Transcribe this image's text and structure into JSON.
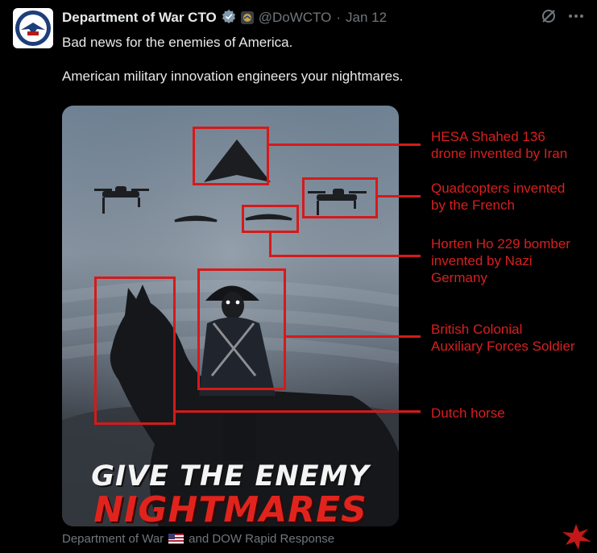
{
  "header": {
    "name": "Department of War CTO",
    "handle": "@DoWCTO",
    "separator": "·",
    "date": "Jan 12"
  },
  "tweet": {
    "text": "Bad news for the enemies of America.\n\nAmerican military innovation engineers your nightmares."
  },
  "poster": {
    "line1": "GIVE THE ENEMY",
    "line2": "NIGHTMARES"
  },
  "annotations": [
    "HESA Shahed 136\ndrone invented by Iran",
    "Quadcopters invented\nby the French",
    "Horten Ho 229 bomber\ninvented by Nazi\nGermany",
    "British Colonial\nAuxiliary Forces Soldier",
    "Dutch horse"
  ],
  "credit": {
    "prefix": "Department of War",
    "suffix": "and DOW Rapid Response"
  },
  "colors": {
    "annotation_red": "#d51a1a",
    "background": "#000000",
    "muted": "#71767b",
    "verified": "#829aab"
  },
  "icons": [
    "verified-badge-icon",
    "grok-icon",
    "more-icon",
    "us-flag-icon"
  ]
}
